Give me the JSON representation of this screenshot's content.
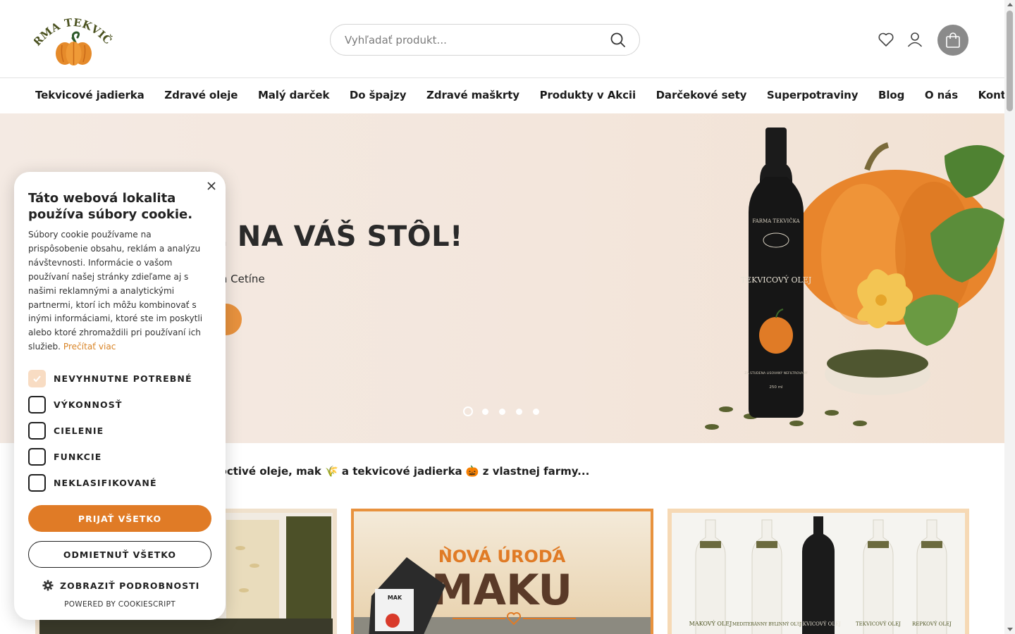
{
  "header": {
    "logo_text": "FARMA TEKVIČKA",
    "search_placeholder": "Vyhľadať produkt...",
    "icons": [
      "heart-icon",
      "user-icon",
      "shopping-bag-icon",
      "search-icon"
    ]
  },
  "nav": {
    "items": [
      {
        "label": "Tekvicové jadierka"
      },
      {
        "label": "Zdravé oleje"
      },
      {
        "label": "Malý darček"
      },
      {
        "label": "Do špajzy"
      },
      {
        "label": "Zdravé maškrty"
      },
      {
        "label": "Produkty v Akcii"
      },
      {
        "label": "Darčekové sety"
      },
      {
        "label": "Superpotraviny"
      },
      {
        "label": "Blog"
      },
      {
        "label": "O nás"
      },
      {
        "label": "Kontakt"
      }
    ]
  },
  "hero": {
    "title_visible": "NKA AŽ NA VÁŠ STÔL!",
    "subtitle_visible": "odinnej farmy v Malom Cetíne",
    "bottle_brand": "FARMA TEKVIČKA",
    "bottle_label": "TEKVICOVÝ OLEJ",
    "bottle_small": "ZA STUDENA LISOVANÝ NEFILTROVANÝ",
    "bottle_volume": "250 ml",
    "slides": 5,
    "active_slide": 1
  },
  "intro": {
    "text_visible": "a slovenské stoly poctivé oleje, mak 🌾 a tekvicové jadierka 🎃 z vlastnej farmy..."
  },
  "cards": {
    "maku_top": "NOVÁ ÚRODA",
    "maku_big": "MAKU",
    "maku_bag": "MAK",
    "oils": [
      "MAKOVÝ OLEJ",
      "MEDITERÁNNY BYLINNÝ OLEJ",
      "TEKVICOVÝ OLEJ",
      "TEKVICOVÝ OLEJ",
      "REPKOVÝ OLEJ"
    ]
  },
  "cookie": {
    "title": "Táto webová lokalita používa súbory cookie.",
    "body": "Súbory cookie používame na prispôsobenie obsahu, reklám a analýzu návštevnosti. Informácie o vašom používaní našej stránky zdieľame aj s našimi reklamnými a analytickými partnermi, ktorí ich môžu kombinovať s inými informáciami, ktoré ste im poskytli alebo ktoré zhromaždili pri používaní ich služieb.",
    "read_more": "Prečítať viac",
    "options": [
      {
        "label": "NEVYHNUTNE POTREBNÉ",
        "checked": true
      },
      {
        "label": "VÝKONNOSŤ",
        "checked": false
      },
      {
        "label": "CIELENIE",
        "checked": false
      },
      {
        "label": "FUNKCIE",
        "checked": false
      },
      {
        "label": "NEKLASIFIKOVANÉ",
        "checked": false
      }
    ],
    "accept_label": "PRIJAŤ VŠETKO",
    "reject_label": "ODMIETNUŤ VŠETKO",
    "details_label": "ZOBRAZIŤ PODROBNOSTI",
    "powered_by": "POWERED BY COOKIESCRIPT"
  },
  "colors": {
    "accent_orange": "#e07b26",
    "hero_cta": "#e8923e",
    "logo_green": "#4b5220",
    "bottle": "#1b1b1b"
  }
}
